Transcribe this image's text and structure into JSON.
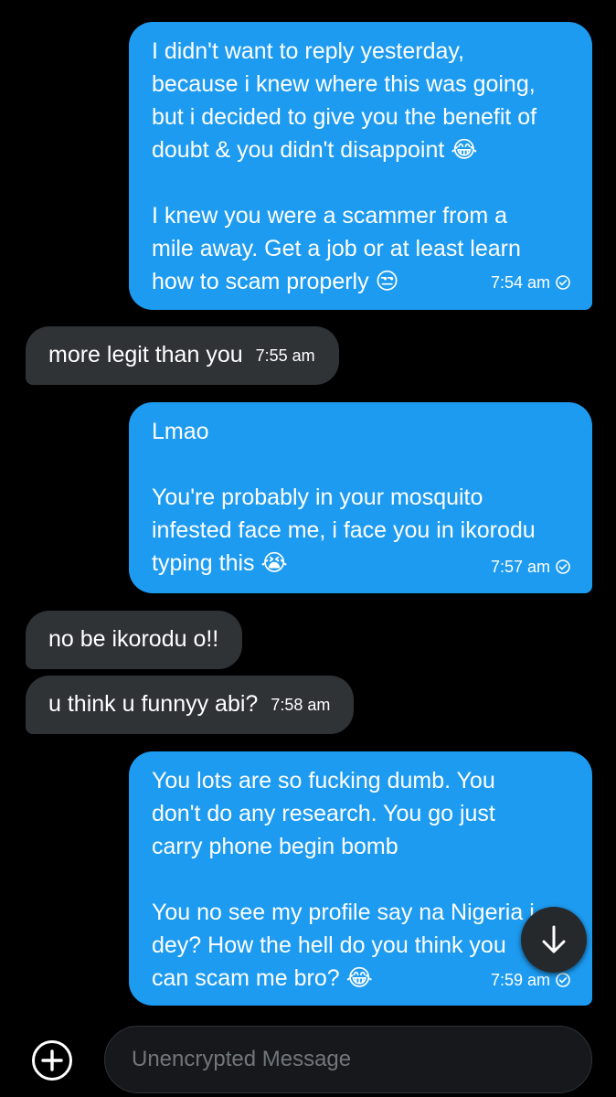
{
  "messages": [
    {
      "direction": "outgoing",
      "lines": [
        "I didn't want to reply yesterday,",
        "because i knew where this was going,",
        "but i decided to give you the benefit of",
        "doubt & you didn't disappoint 😂",
        "",
        "I knew you were a scammer from a",
        "mile away. Get a job or at least learn",
        "how to scam properly 😒"
      ],
      "time": "7:54 am",
      "status_icon": "check-circle-icon"
    },
    {
      "direction": "incoming",
      "lines": [
        "more legit than you"
      ],
      "time": "7:55 am"
    },
    {
      "direction": "outgoing",
      "lines": [
        "Lmao",
        "",
        "You're probably in your mosquito",
        "infested face me, i face you in ikorodu",
        "typing this 😭"
      ],
      "time": "7:57 am",
      "status_icon": "check-circle-icon"
    },
    {
      "direction": "incoming",
      "lines": [
        "no be ikorodu o!!"
      ],
      "time": ""
    },
    {
      "direction": "incoming",
      "lines": [
        "u think u funnyy abi?"
      ],
      "time": "7:58 am"
    },
    {
      "direction": "outgoing",
      "lines": [
        "You lots are so fucking dumb. You",
        "don't do any research. You go just",
        "carry phone begin bomb",
        "",
        "You no see my profile say na Nigeria i",
        "dey? How the hell do you think you",
        "can scam me bro? 😂"
      ],
      "time": "7:59 am",
      "status_icon": "check-circle-icon"
    }
  ],
  "composer": {
    "placeholder": "Unencrypted Message",
    "add_icon": "plus-circle-icon"
  },
  "scroll_button_icon": "arrow-down-icon",
  "colors": {
    "outgoing_bubble": "#1d9bf0",
    "incoming_bubble": "#2f3336",
    "background": "#000000"
  }
}
